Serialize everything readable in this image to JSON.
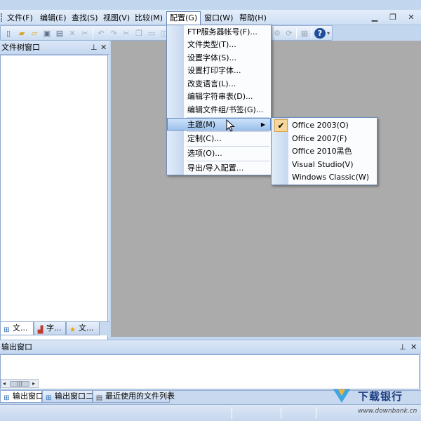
{
  "menubar": {
    "items": [
      "文件(F)",
      "编辑(E)",
      "查找(S)",
      "视图(V)",
      "比较(M)",
      "配置(G)",
      "窗口(W)",
      "帮助(H)"
    ],
    "open_item": "配置(G)",
    "mdi_controls": [
      "minimize-icon",
      "restore-icon",
      "close-icon"
    ]
  },
  "toolbar": {
    "icons": [
      "new-file-icon",
      "new-folder-icon",
      "open-file-icon",
      "save-icon",
      "save-all-icon",
      "delete-icon",
      "cut-icon",
      "undo-icon",
      "redo-icon",
      "scissors-icon",
      "copy-icon",
      "paste-icon",
      "compare-icon",
      "filter-icon",
      "sync-icon",
      "options-icon",
      "help-icon"
    ]
  },
  "left_panel": {
    "title": "文件树窗口",
    "tabs": [
      {
        "label": "文...",
        "icon": "file-tree-icon"
      },
      {
        "label": "字...",
        "icon": "chart-icon"
      },
      {
        "label": "文...",
        "icon": "star-icon"
      }
    ]
  },
  "output_panel": {
    "title": "输出窗口",
    "tabs": [
      {
        "label": "输出窗口",
        "icon": "output-icon"
      },
      {
        "label": "输出窗口二",
        "icon": "output-icon"
      },
      {
        "label": "最近使用的文件列表",
        "icon": "recent-files-icon"
      }
    ]
  },
  "config_menu": {
    "items": [
      {
        "label": "FTP服务器帐号(F)..."
      },
      {
        "label": "文件类型(T)..."
      },
      {
        "label": "设置字体(S)..."
      },
      {
        "label": "设置打印字体..."
      },
      {
        "label": "改变语言(L)..."
      },
      {
        "label": "编辑字符串表(D)..."
      },
      {
        "label": "编辑文件组/书签(G)..."
      },
      {
        "label": "主题(M)",
        "submenu": true,
        "highlighted": true
      },
      {
        "label": "定制(C)..."
      },
      {
        "label": "选项(O)..."
      },
      {
        "label": "导出/导入配置..."
      }
    ]
  },
  "theme_submenu": {
    "items": [
      {
        "label": "Office 2003(O)",
        "checked": true
      },
      {
        "label": "Office 2007(F)",
        "checked": false
      },
      {
        "label": "Office 2010黑色",
        "checked": false
      },
      {
        "label": "Visual Studio(V)",
        "checked": false
      },
      {
        "label": "Windows Classic(W)",
        "checked": false
      }
    ]
  },
  "watermark": {
    "title": "下载银行",
    "url": "www.downbank.cn"
  },
  "colors": {
    "accent": "#5c88c5",
    "workspace": "#ababab",
    "checked_bg": "#f6d79a"
  }
}
